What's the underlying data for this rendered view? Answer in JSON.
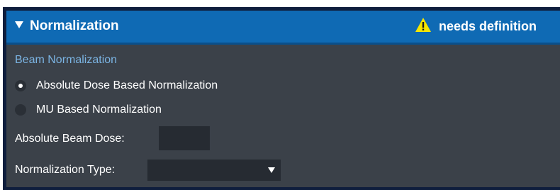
{
  "header": {
    "title": "Normalization",
    "collapse_icon": "triangle-down-icon",
    "status_icon": "warning-icon",
    "status_text": "needs definition",
    "background_color": "#0f6ab4",
    "warning_color": "#f5e600"
  },
  "beam_normalization": {
    "section_label": "Beam Normalization",
    "options": [
      {
        "label": "Absolute Dose Based Normalization",
        "selected": true
      },
      {
        "label": "MU Based Normalization",
        "selected": false
      }
    ]
  },
  "absolute_beam_dose": {
    "label": "Absolute Beam Dose:",
    "value": ""
  },
  "normalization_type": {
    "label": "Normalization Type:",
    "selected": "",
    "dropdown_icon": "chevron-down-icon"
  }
}
